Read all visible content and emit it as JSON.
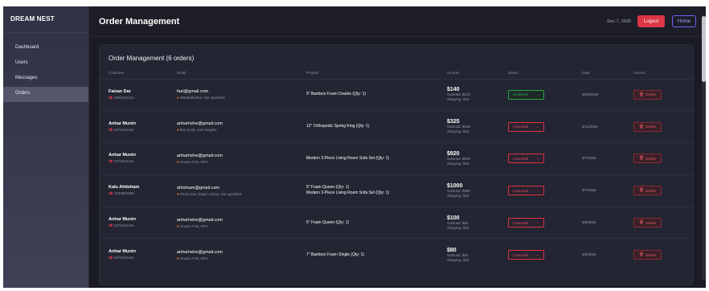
{
  "brand": "DREAM NEST",
  "sidebar": {
    "items": [
      {
        "label": "Dashboard"
      },
      {
        "label": "Users"
      },
      {
        "label": "Messages"
      },
      {
        "label": "Orders"
      }
    ]
  },
  "header": {
    "title": "Order Management",
    "date": "Dec 7, 2025",
    "logout_label": "Logout",
    "home_label": "Home"
  },
  "card": {
    "title": "Order Management (6 orders)"
  },
  "table": {
    "columns": [
      "Customer",
      "Email",
      "Product",
      "Amount",
      "Status",
      "Date",
      "Actions"
    ],
    "delete_label": "Delete",
    "rows": [
      {
        "name": "Faizan Dar",
        "phone": "2891251312",
        "email": "fasi@gmail.com",
        "address": "dfadfadfasfsa, Not specified",
        "products": [
          "9\" Bamboo Foam Double (Qty: 1)"
        ],
        "amount": "$140",
        "subtotal": "Subtotal: $120",
        "shipping": "Shipping: $20",
        "status": "Delivered",
        "date": "9/20/2025"
      },
      {
        "name": "Anhar Munirr",
        "phone": "4371616161",
        "email": "anharhehe@gmail.com",
        "address": "flat no 08, sare heights",
        "products": [
          "12\" Orthopedic Spring King (Qty: 1)"
        ],
        "amount": "$325",
        "subtotal": "Subtotal: $305",
        "shipping": "Shipping: $20",
        "status": "Canceled",
        "date": "9/11/2025"
      },
      {
        "name": "Anhar Munirr",
        "phone": "4371616161",
        "email": "anharhehe@gmail.com",
        "address": "House # 02, DPS",
        "products": [
          "Modern 3-Piece Living Room Sofa Set (Qty: 1)"
        ],
        "amount": "$920",
        "subtotal": "Subtotal: $900",
        "shipping": "Shipping: $20",
        "status": "Canceled",
        "date": "9/7/2025"
      },
      {
        "name": "Kalu Ahtisham",
        "phone": "1234567890",
        "email": "ahtisham@gmail.com",
        "address": "Pindi-near chapri colony, Not specified",
        "products": [
          "5\" Foam Queen (Qty: 1)",
          "Modern 3-Piece Living Room Sofa Set (Qty: 1)"
        ],
        "amount": "$1000",
        "subtotal": "Subtotal: $980",
        "shipping": "Shipping: $20",
        "status": "Canceled",
        "date": "9/7/2025"
      },
      {
        "name": "Anhar Munirr",
        "phone": "4371616161",
        "email": "anharhehe@gmail.com",
        "address": "House # 02, DPS",
        "products": [
          "5\" Foam Queen (Qty: 1)"
        ],
        "amount": "$100",
        "subtotal": "Subtotal: $80",
        "shipping": "Shipping: $20",
        "status": "Canceled",
        "date": "9/6/2025"
      },
      {
        "name": "Anhar Munirr",
        "phone": "4371616161",
        "email": "anharhehe@gmail.com",
        "address": "House # 02, DPS",
        "products": [
          "7\" Bamboo Foam Single (Qty: 1)"
        ],
        "amount": "$80",
        "subtotal": "Subtotal: $60",
        "shipping": "Shipping: $20",
        "status": "Canceled",
        "date": "9/6/2025"
      }
    ]
  },
  "colors": {
    "accent": "#6c63ff",
    "danger": "#dc3545",
    "success": "#28a745",
    "pin": "#ff8c00"
  },
  "icons": [
    "phone-icon",
    "map-pin-icon",
    "trash-icon",
    "chevron-down-icon"
  ]
}
